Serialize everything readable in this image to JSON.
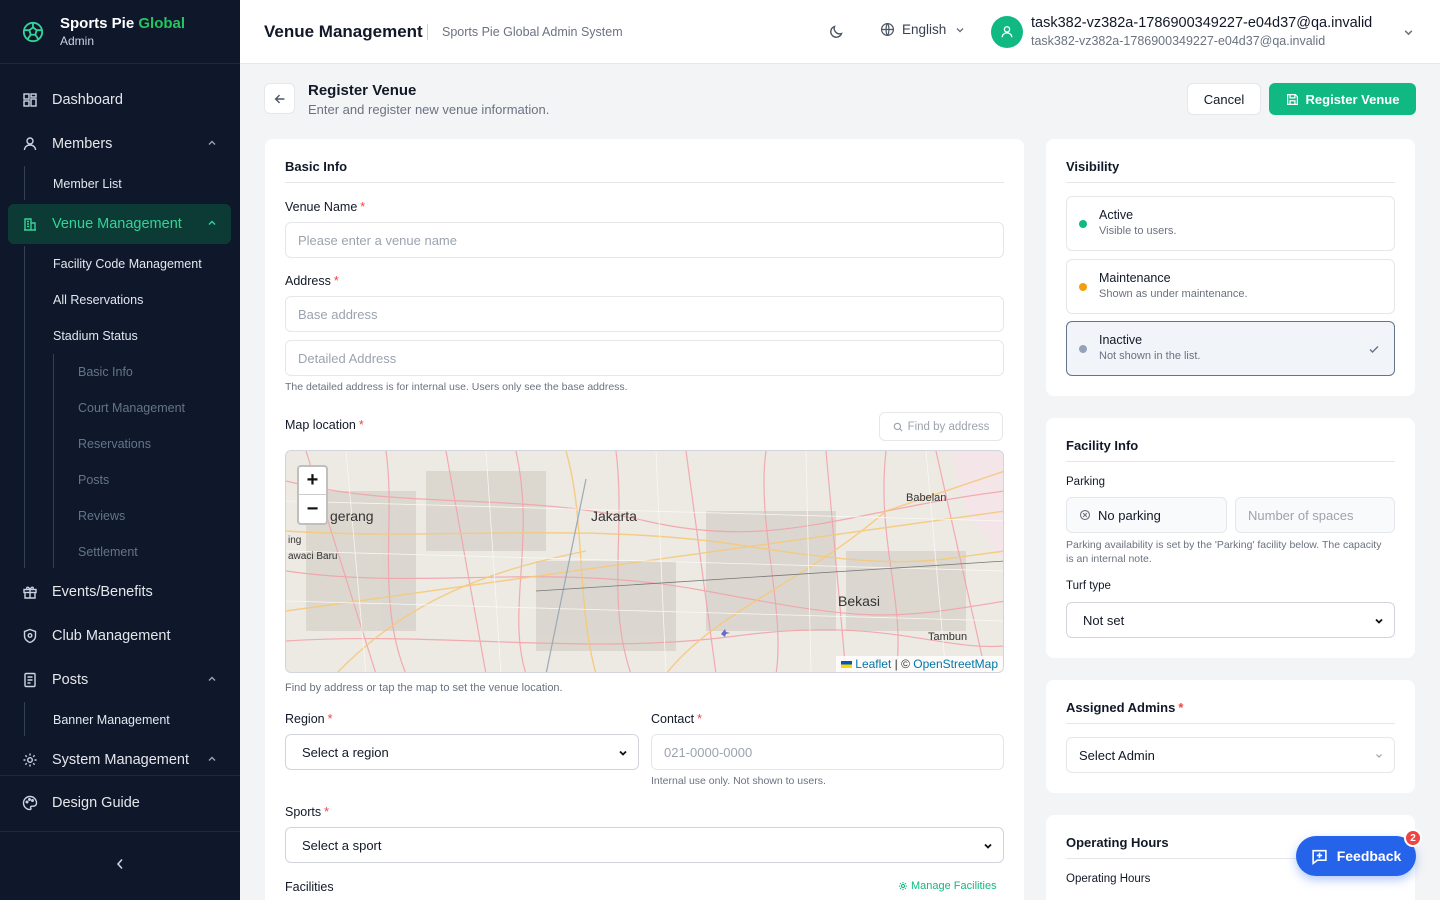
{
  "brand": {
    "name_main": "Sports Pie",
    "name_accent": "Global",
    "role": "Admin"
  },
  "sidebar": {
    "dashboard": "Dashboard",
    "members": "Members",
    "member_list": "Member List",
    "venue_management": "Venue Management",
    "venue_subs": [
      "Facility Code Management",
      "All Reservations",
      "Stadium Status"
    ],
    "stadium_subs": [
      "Basic Info",
      "Court Management",
      "Reservations",
      "Posts",
      "Reviews",
      "Settlement"
    ],
    "events": "Events/Benefits",
    "club": "Club Management",
    "posts": "Posts",
    "banner": "Banner Management",
    "system": "System Management",
    "design_guide": "Design Guide"
  },
  "header": {
    "title": "Venue Management",
    "subtitle": "Sports Pie Global Admin System",
    "language": "English",
    "user_name": "task382-vz382a-1786900349227-e04d37@qa.invalid",
    "user_email": "task382-vz382a-1786900349227-e04d37@qa.invalid"
  },
  "page": {
    "title": "Register Venue",
    "subtitle": "Enter and register new venue information.",
    "cancel": "Cancel",
    "register": "Register Venue"
  },
  "basic": {
    "title": "Basic Info",
    "venue_name_label": "Venue Name",
    "venue_name_ph": "Please enter a venue name",
    "address_label": "Address",
    "base_address_ph": "Base address",
    "detail_address_ph": "Detailed Address",
    "address_hint": "The detailed address is for internal use. Users only see the base address.",
    "map_label": "Map location",
    "find_by_address": "Find by address",
    "map_hint": "Find by address or tap the map to set the venue location.",
    "region_label": "Region",
    "region_value": "Select a region",
    "contact_label": "Contact",
    "contact_ph": "021-0000-0000",
    "contact_hint": "Internal use only. Not shown to users.",
    "sports_label": "Sports",
    "sports_value": "Select a sport",
    "facilities_label": "Facilities",
    "manage_facilities": "Manage Facilities",
    "required_mark": "*"
  },
  "map": {
    "zoom_in": "+",
    "zoom_out": "−",
    "places": [
      "Jakarta",
      "gerang",
      "Babelan",
      "Bekasi",
      "Tambun",
      "awaci Baru",
      "ing"
    ],
    "attr_leaflet": "Leaflet",
    "attr_sep": " | © ",
    "attr_osm": "OpenStreetMap"
  },
  "visibility": {
    "title": "Visibility",
    "options": [
      {
        "label": "Active",
        "desc": "Visible to users.",
        "color": "#10b981"
      },
      {
        "label": "Maintenance",
        "desc": "Shown as under maintenance.",
        "color": "#f59e0b"
      },
      {
        "label": "Inactive",
        "desc": "Not shown in the list.",
        "color": "#94a3b8"
      }
    ]
  },
  "facility": {
    "title": "Facility Info",
    "parking_label": "Parking",
    "no_parking": "No parking",
    "spaces_ph": "Number of spaces",
    "parking_hint": "Parking availability is set by the 'Parking' facility below. The capacity is an internal note.",
    "turf_label": "Turf type",
    "turf_value": "Not set"
  },
  "admins": {
    "title": "Assigned Admins",
    "select": "Select Admin"
  },
  "hours": {
    "title": "Operating Hours",
    "label": "Operating Hours"
  },
  "feedback": {
    "label": "Feedback",
    "count": "2"
  }
}
